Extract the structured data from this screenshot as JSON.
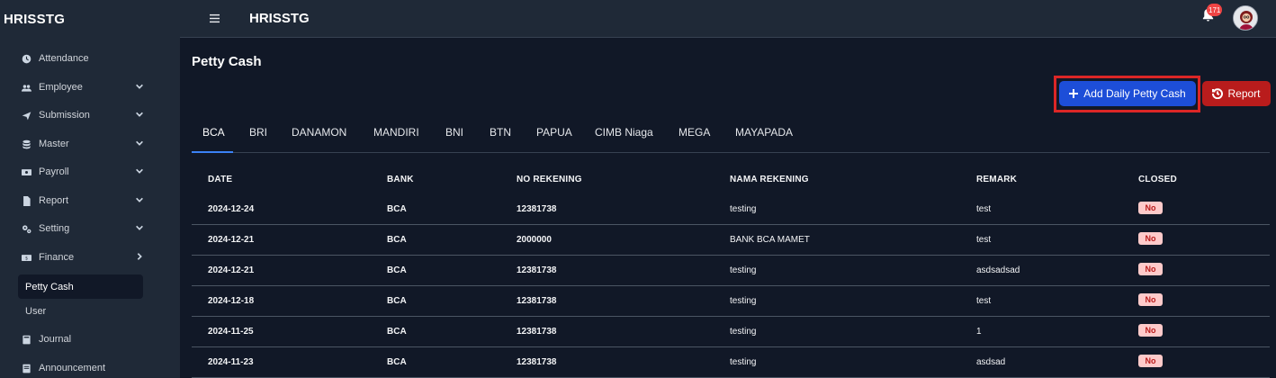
{
  "app": {
    "brand": "HRISSTG",
    "title": "HRISSTG",
    "notification_count": "171"
  },
  "sidebar": {
    "items": [
      {
        "label": "Attendance",
        "icon": "clock-icon",
        "chevron": ""
      },
      {
        "label": "Employee",
        "icon": "users-icon",
        "chevron": "down"
      },
      {
        "label": "Submission",
        "icon": "paper-plane-icon",
        "chevron": "down"
      },
      {
        "label": "Master",
        "icon": "database-icon",
        "chevron": "down"
      },
      {
        "label": "Payroll",
        "icon": "money-icon",
        "chevron": "down"
      },
      {
        "label": "Report",
        "icon": "file-icon",
        "chevron": "down"
      },
      {
        "label": "Setting",
        "icon": "gears-icon",
        "chevron": "down"
      },
      {
        "label": "Finance",
        "icon": "cash-icon",
        "chevron": "right"
      }
    ],
    "sub_items": [
      {
        "label": "Petty Cash",
        "active": true
      },
      {
        "label": "User",
        "active": false
      }
    ],
    "bottom_items": [
      {
        "label": "Journal",
        "icon": "book-icon"
      },
      {
        "label": "Announcement",
        "icon": "megaphone-icon"
      }
    ]
  },
  "page": {
    "title": "Petty Cash",
    "add_button": "Add Daily Petty Cash",
    "report_button": "Report"
  },
  "tabs": [
    "BCA",
    "BRI",
    "DANAMON",
    "MANDIRI",
    "BNI",
    "BTN",
    "PAPUA",
    "CIMB Niaga",
    "MEGA",
    "MAYAPADA"
  ],
  "table": {
    "headers": [
      "DATE",
      "BANK",
      "NO REKENING",
      "NAMA REKENING",
      "REMARK",
      "CLOSED"
    ],
    "rows": [
      [
        "2024-12-24",
        "BCA",
        "12381738",
        "testing",
        "test",
        "No"
      ],
      [
        "2024-12-21",
        "BCA",
        "2000000",
        "BANK BCA MAMET",
        "test",
        "No"
      ],
      [
        "2024-12-21",
        "BCA",
        "12381738",
        "testing",
        "asdsadsad",
        "No"
      ],
      [
        "2024-12-18",
        "BCA",
        "12381738",
        "testing",
        "test",
        "No"
      ],
      [
        "2024-11-25",
        "BCA",
        "12381738",
        "testing",
        "1",
        "No"
      ],
      [
        "2024-11-23",
        "BCA",
        "12381738",
        "testing",
        "asdsad",
        "No"
      ]
    ]
  },
  "colors": {
    "primary": "#1d4ed8",
    "danger": "#b91c1c",
    "sidebar_bg": "#1f2937",
    "content_bg": "#111827"
  }
}
